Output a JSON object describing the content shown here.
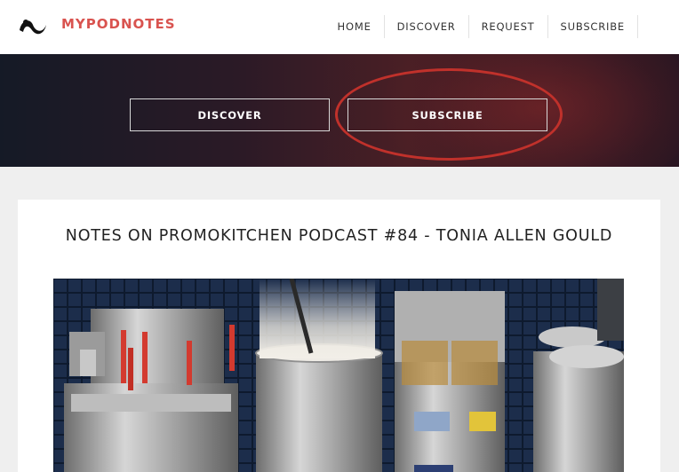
{
  "header": {
    "brand": "MYPODNOTES",
    "nav": [
      "HOME",
      "DISCOVER",
      "REQUEST",
      "SUBSCRIBE"
    ],
    "twitter_icon": "twitter-icon",
    "brand_color": "#d9534f"
  },
  "hero": {
    "discover_label": "DISCOVER",
    "subscribe_label": "SUBSCRIBE",
    "annotation_color": "#c0312b"
  },
  "post": {
    "title": "NOTES ON PROMOKITCHEN PODCAST #84 - TONIA ALLEN GOULD"
  }
}
